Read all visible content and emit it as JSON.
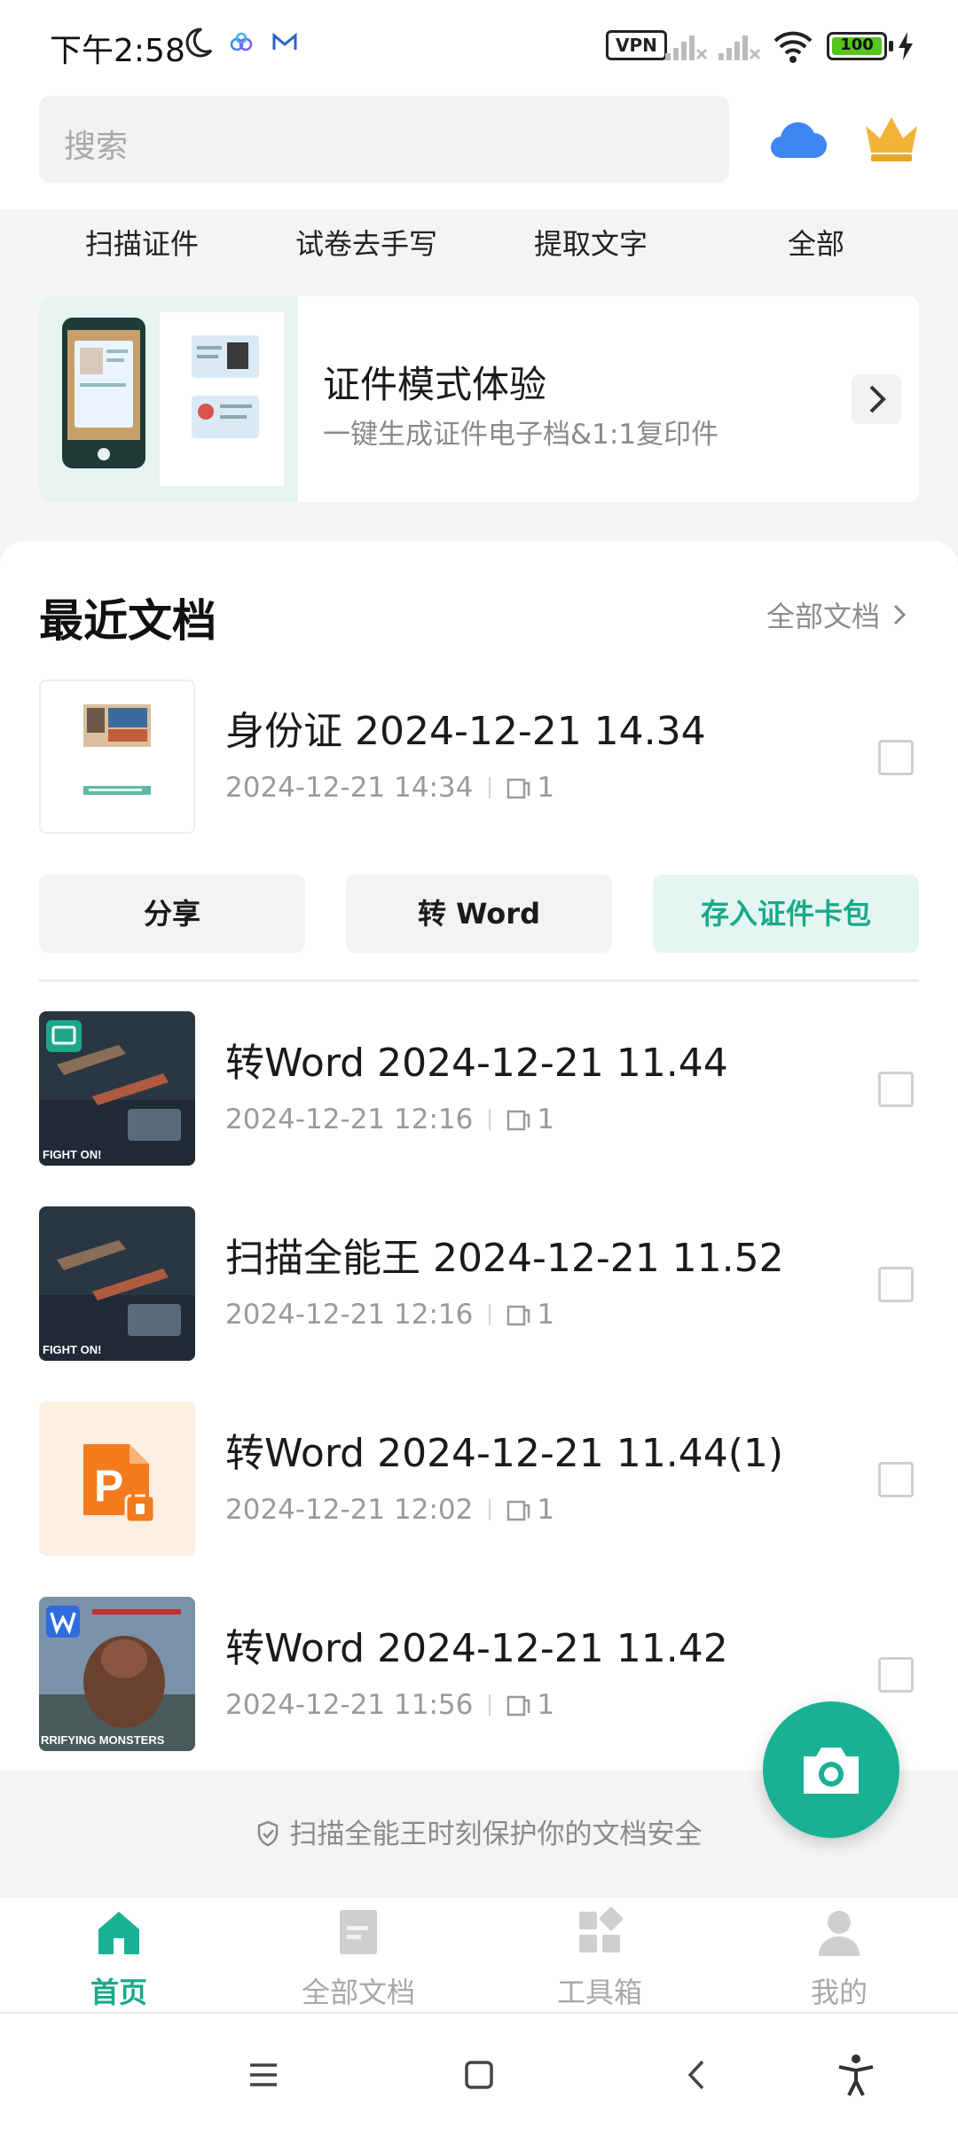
{
  "status_bar": {
    "time": "下午2:58",
    "vpn_label": "VPN",
    "battery_level": "100",
    "battery_fraction": 1.0
  },
  "search": {
    "placeholder": "搜索"
  },
  "header_icons": [
    "cloud-icon",
    "crown-icon"
  ],
  "quick_tabs": [
    "扫描证件",
    "试卷去手写",
    "提取文字",
    "全部"
  ],
  "promo": {
    "title": "证件模式体验",
    "subtitle": "一键生成证件电子档&1:1复印件"
  },
  "recent": {
    "title": "最近文档",
    "all_link": "全部文档"
  },
  "documents": [
    {
      "name": "身份证 2024-12-21 14.34",
      "date": "2024-12-21 14:34",
      "pages": "1",
      "thumb": "id-card-scan"
    },
    {
      "name": "转Word 2024-12-21 11.44",
      "date": "2024-12-21 12:16",
      "pages": "1",
      "thumb": "game-screenshot",
      "thumb_caption": "FIGHT ON!"
    },
    {
      "name": "扫描全能王 2024-12-21 11.52",
      "date": "2024-12-21 12:16",
      "pages": "1",
      "thumb": "game-screenshot",
      "thumb_caption": "FIGHT ON!"
    },
    {
      "name": "转Word 2024-12-21 11.44(1)",
      "date": "2024-12-21 12:02",
      "pages": "1",
      "thumb": "locked-ppt-file"
    },
    {
      "name": "转Word 2024-12-21 11.42",
      "date": "2024-12-21 11:56",
      "pages": "1",
      "thumb": "game-screenshot",
      "thumb_caption": "RRIFYING MONSTERS"
    }
  ],
  "actions": {
    "share": "分享",
    "to_word": "转 Word",
    "save_card": "存入证件卡包"
  },
  "safety_text": "扫描全能王时刻保护你的文档安全",
  "nav": {
    "home": "首页",
    "all_docs": "全部文档",
    "toolbox": "工具箱",
    "mine": "我的"
  },
  "colors": {
    "accent": "#19b193",
    "accent_text": "#19a98b",
    "accent_bg": "#e4f6f2",
    "cloud": "#3f86f0",
    "crown": "#f2b437"
  }
}
